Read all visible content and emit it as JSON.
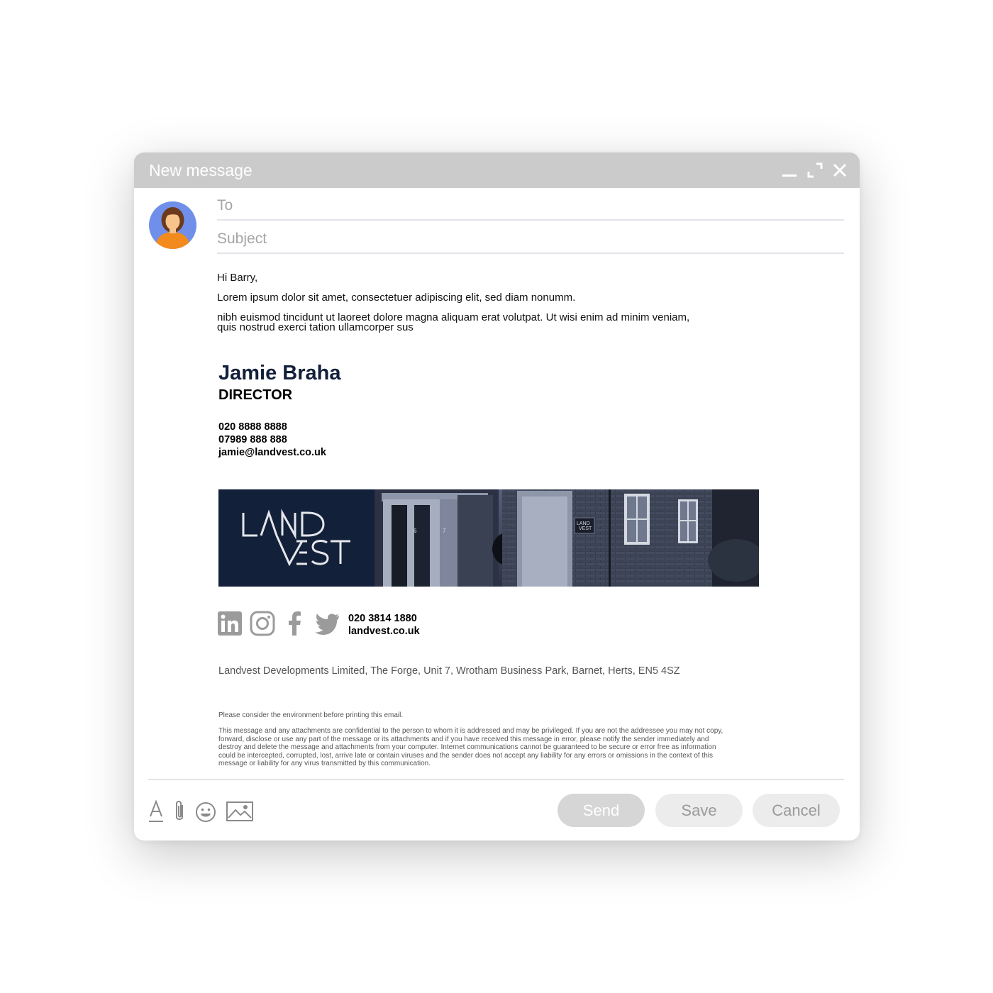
{
  "window": {
    "title": "New message"
  },
  "compose": {
    "to_placeholder": "To",
    "subject_placeholder": "Subject"
  },
  "body": {
    "greeting": "Hi Barry,",
    "line1": "Lorem ipsum dolor sit amet, consectetuer adipiscing elit, sed diam nonumm.",
    "line2a": "nibh euismod tincidunt ut laoreet dolore magna aliquam erat volutpat. Ut wisi enim ad minim veniam,",
    "line2b": "quis nostrud exerci tation ullamcorper sus"
  },
  "signature": {
    "name": "Jamie Braha",
    "title": "DIRECTOR",
    "phone": "020 8888 8888",
    "mobile": "07989 888 888",
    "email": "jamie@landvest.co.uk",
    "logo_text": "LANDVEST",
    "banner_logo_small": "LANDVEST",
    "door_numbers": [
      "6",
      "7"
    ],
    "office_phone": "020 3814 1880",
    "website": "landvest.co.uk",
    "address": "Landvest Developments Limited, The Forge, Unit 7, Wrotham Business Park, Barnet, Herts, EN5 4SZ",
    "environment_note": "Please consider the environment before printing this email.",
    "disclaimer_lines": [
      "This message and any attachments are confidential to the person to whom it is addressed and may be privileged. If you are not the addressee you may not copy,",
      "forward, disclose or use any part of the message or its attachments and if you have received this message in error, please notify the sender immediately and",
      "destroy and delete the message and attachments from your computer. Internet communications cannot be guaranteed to be secure or error free as information",
      "could be intercepted, corrupted, lost, arrive late or contain viruses and the sender does not accept any liability for any errors or omissions in the context of this",
      "message or liability for any virus transmitted by this communication."
    ],
    "social_icons": [
      "linkedin-icon",
      "instagram-icon",
      "facebook-icon",
      "twitter-icon"
    ]
  },
  "toolbar": {
    "icons": [
      "text-format-icon",
      "attachment-icon",
      "emoji-icon",
      "image-icon"
    ],
    "send_label": "Send",
    "save_label": "Save",
    "cancel_label": "Cancel"
  },
  "colors": {
    "titlebar": "#cbcbcb",
    "send_button": "#d6d6d6",
    "secondary_button": "#ececec",
    "name_color": "#12203a",
    "banner_navy": "#13203a",
    "icon_gray": "#9b9b9b"
  }
}
